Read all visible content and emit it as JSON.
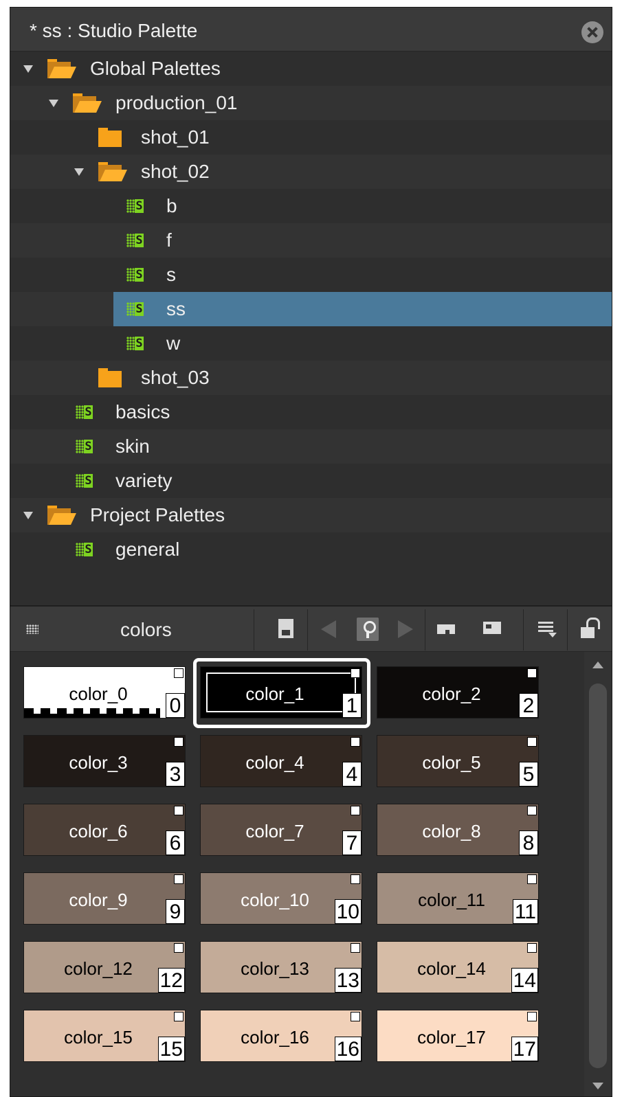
{
  "window": {
    "title": "* ss : Studio Palette"
  },
  "tree": {
    "items": [
      {
        "label": "Global Palettes",
        "kind": "folder-open",
        "expanded": true,
        "level": 0
      },
      {
        "label": "production_01",
        "kind": "folder-open",
        "expanded": true,
        "level": 1
      },
      {
        "label": "shot_01",
        "kind": "folder",
        "expanded": false,
        "level": 2
      },
      {
        "label": "shot_02",
        "kind": "folder-open",
        "expanded": true,
        "level": 2
      },
      {
        "label": "b",
        "kind": "palette",
        "level": 3
      },
      {
        "label": "f",
        "kind": "palette",
        "level": 3
      },
      {
        "label": "s",
        "kind": "palette",
        "level": 3
      },
      {
        "label": "ss",
        "kind": "palette",
        "level": 3,
        "selected": true
      },
      {
        "label": "w",
        "kind": "palette",
        "level": 3
      },
      {
        "label": "shot_03",
        "kind": "folder",
        "expanded": false,
        "level": 2
      },
      {
        "label": "basics",
        "kind": "palette",
        "level": 1
      },
      {
        "label": "skin",
        "kind": "palette",
        "level": 1
      },
      {
        "label": "variety",
        "kind": "palette",
        "level": 1
      },
      {
        "label": "Project Palettes",
        "kind": "folder-open",
        "expanded": true,
        "level": 0
      },
      {
        "label": "general",
        "kind": "palette",
        "level": 1
      }
    ],
    "palette_icon_letter": "S"
  },
  "palette_view": {
    "name": "colors",
    "selected_index": 1,
    "toolbar_icons": [
      "grid-view-icon",
      "save-icon",
      "previous-icon",
      "key-icon",
      "next-icon",
      "new-style-icon",
      "new-page-icon",
      "menu-icon",
      "lock-icon"
    ],
    "swatches": [
      {
        "name": "color_0",
        "index": "0",
        "color": "#ffffff",
        "text": "#000000"
      },
      {
        "name": "color_1",
        "index": "1",
        "color": "#000000",
        "text": "#ffffff"
      },
      {
        "name": "color_2",
        "index": "2",
        "color": "#0d0b0a",
        "text": "#ffffff"
      },
      {
        "name": "color_3",
        "index": "3",
        "color": "#201a17",
        "text": "#ffffff"
      },
      {
        "name": "color_4",
        "index": "4",
        "color": "#302620",
        "text": "#ffffff"
      },
      {
        "name": "color_5",
        "index": "5",
        "color": "#3d312a",
        "text": "#ffffff"
      },
      {
        "name": "color_6",
        "index": "6",
        "color": "#4b3e36",
        "text": "#ffffff"
      },
      {
        "name": "color_7",
        "index": "7",
        "color": "#5a4b42",
        "text": "#ffffff"
      },
      {
        "name": "color_8",
        "index": "8",
        "color": "#6a594f",
        "text": "#ffffff"
      },
      {
        "name": "color_9",
        "index": "9",
        "color": "#7b6a5f",
        "text": "#ffffff"
      },
      {
        "name": "color_10",
        "index": "10",
        "color": "#8d7b6f",
        "text": "#ffffff"
      },
      {
        "name": "color_11",
        "index": "11",
        "color": "#a18e80",
        "text": "#000000"
      },
      {
        "name": "color_12",
        "index": "12",
        "color": "#b09b8a",
        "text": "#000000"
      },
      {
        "name": "color_13",
        "index": "13",
        "color": "#c3ab98",
        "text": "#000000"
      },
      {
        "name": "color_14",
        "index": "14",
        "color": "#d6bca6",
        "text": "#000000"
      },
      {
        "name": "color_15",
        "index": "15",
        "color": "#e2c3ad",
        "text": "#000000"
      },
      {
        "name": "color_16",
        "index": "16",
        "color": "#f0d0b8",
        "text": "#000000"
      },
      {
        "name": "color_17",
        "index": "17",
        "color": "#fcdcc4",
        "text": "#000000"
      }
    ]
  },
  "colors": {
    "selection": "#4a7a9b",
    "folder": "#f7a21a",
    "palette_icon": "#7ed321"
  }
}
